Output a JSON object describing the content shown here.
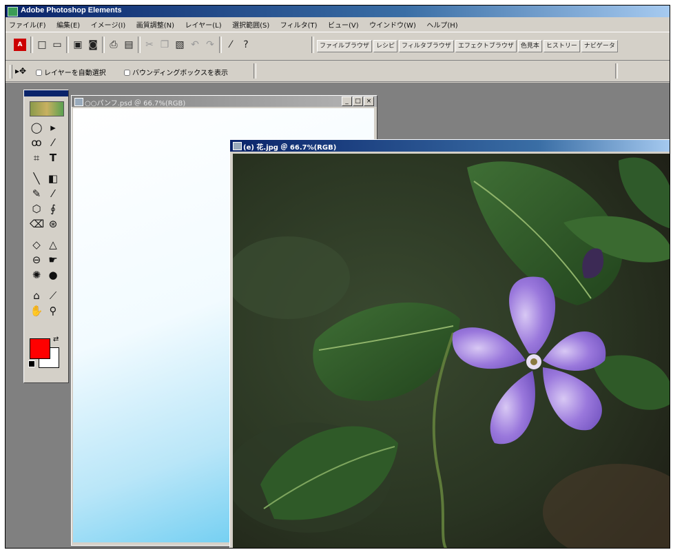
{
  "app": {
    "title": "Adobe Photoshop Elements"
  },
  "menu": [
    "ファイル(F)",
    "編集(E)",
    "イメージ(I)",
    "画質調整(N)",
    "レイヤー(L)",
    "選択範囲(S)",
    "フィルタ(T)",
    "ビュー(V)",
    "ウインドウ(W)",
    "ヘルプ(H)"
  ],
  "palette_tabs": [
    "ファイルブラウザ",
    "レシピ",
    "フィルタブラウザ",
    "エフェクトブラウザ",
    "色見本",
    "ヒストリー",
    "ナビゲータ"
  ],
  "options": {
    "auto_select_layer": "レイヤーを自動選択",
    "show_bounding_box": "バウンディングボックスを表示"
  },
  "documents": [
    {
      "title": "○○パンフ.psd ＠ 66.7%(RGB)",
      "active": false
    },
    {
      "title": "(e) 花.jpg ＠ 66.7%(RGB)",
      "active": true
    }
  ],
  "colors": {
    "foreground": "#ff0000",
    "background": "#ffffff"
  },
  "icons": {
    "toolbar": [
      "new-icon",
      "open-icon",
      "save-icon",
      "save-for-web-icon",
      "print-icon",
      "print-preview-icon",
      "cut-icon",
      "copy-icon",
      "paste-icon",
      "undo-icon",
      "redo-icon",
      "brush-icon",
      "help-icon"
    ]
  }
}
